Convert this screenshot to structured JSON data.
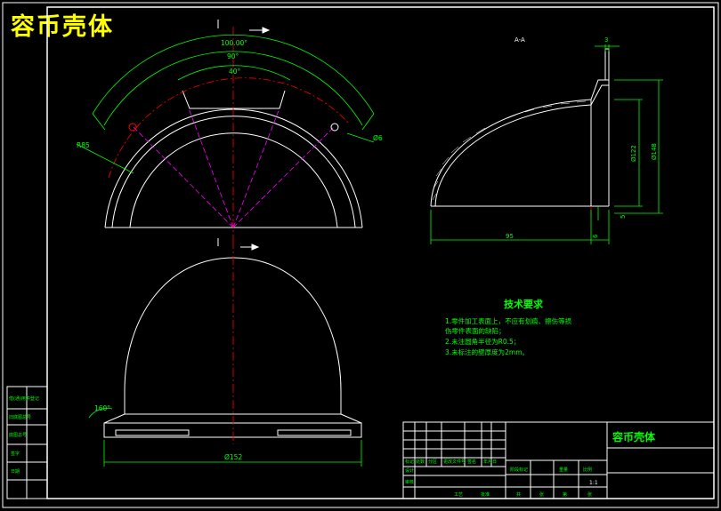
{
  "drawing_title": "容币壳体",
  "colors": {
    "background": "#000000",
    "outline": "#ffffff",
    "dimension": "#00ff00",
    "centerline": "#ff0000",
    "hidden": "#ff00ff",
    "title": "#ffff00"
  },
  "dimensions": {
    "angle_outer": "100.00°",
    "angle_mid": "90°",
    "angle_inner": "40°",
    "radius_left": "R85",
    "dia_right": "Ø6",
    "top_view_corner": "160°",
    "base_dia": "Ø152",
    "thickness_top": "3",
    "dia_inner_h": "Ø122",
    "dia_outer_h": "Ø148",
    "small_gap": "5",
    "length_95": "95",
    "length_6": "6",
    "section_mark": "A-A"
  },
  "tech_requirements": {
    "title": "技术要求",
    "lines": [
      "1.零件加工表面上，不应有划痕、擦伤等损",
      "伤零件表面的缺陷；",
      "2.未注圆角半径为R0.5；",
      "3.未标注的壁厚度为2mm。"
    ]
  },
  "title_block": {
    "part_name": "容币壳体",
    "scale": "1:1",
    "labels": [
      "标记",
      "处数",
      "分区",
      "更改文件号",
      "签名",
      "年月日",
      "阶段标记",
      "重量",
      "比例",
      "共",
      "张",
      "第",
      "张",
      "设计",
      "审核",
      "工艺",
      "批准"
    ]
  },
  "side_strip": {
    "labels": [
      "借(通)用件登记",
      "旧底图总号",
      "底图总号",
      "签字",
      "日期"
    ]
  }
}
